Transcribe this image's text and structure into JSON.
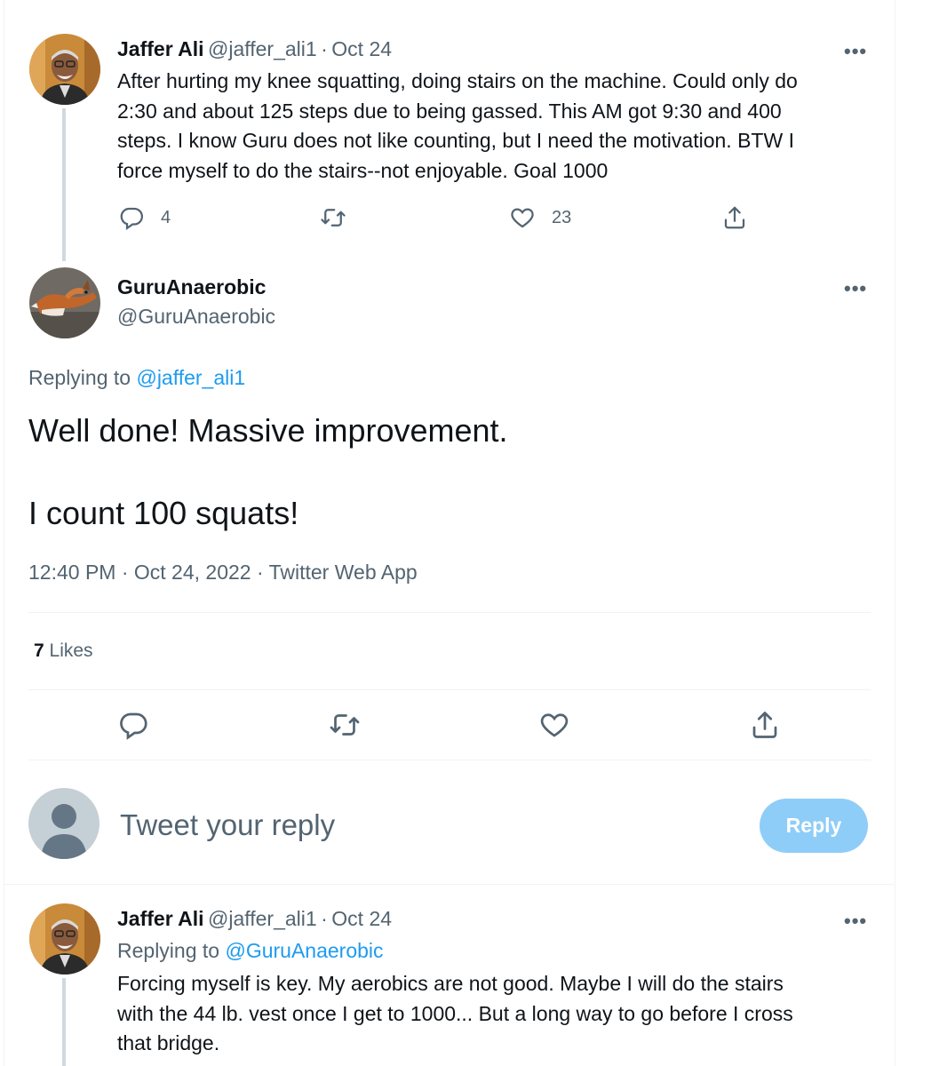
{
  "tweet1": {
    "name": "Jaffer Ali",
    "handle": "@jaffer_ali1",
    "sep": "·",
    "date": "Oct 24",
    "lines": [
      "After hurting my knee squatting, doing stairs on the machine. Could only do",
      "2:30 and about 125 steps due to being gassed. This AM got 9:30 and 400",
      "steps. I know Guru does not like counting, but I need the motivation. BTW I",
      "force myself to do the stairs--not enjoyable. Goal 1000"
    ],
    "reply_count": "4",
    "like_count": "23",
    "more": "•••"
  },
  "main_tweet": {
    "name": "GuruAnaerobic",
    "handle": "@GuruAnaerobic",
    "replying_prefix": "Replying to",
    "replying_handle": "@jaffer_ali1",
    "text_line1": "Well done! Massive improvement.",
    "text_line2": "I count 100 squats!",
    "timestamp": "12:40 PM · Oct 24, 2022 · Twitter Web App",
    "likes_count": "7",
    "likes_label": "Likes",
    "more": "•••"
  },
  "compose": {
    "placeholder": "Tweet your reply",
    "button_label": "Reply"
  },
  "tweet3": {
    "name": "Jaffer Ali",
    "handle": "@jaffer_ali1",
    "sep": "·",
    "date": "Oct 24",
    "replying_prefix": "Replying to",
    "replying_handle": "@GuruAnaerobic",
    "lines": [
      "Forcing myself is key. My aerobics are not good. Maybe I will do the stairs",
      "with the 44 lb. vest once I get to 1000... But a long way to go before I cross",
      "that bridge."
    ],
    "more": "•••"
  },
  "icons": {
    "reply": "reply-icon",
    "retweet": "retweet-icon",
    "like": "heart-icon",
    "share": "share-icon",
    "more": "more-icon"
  },
  "colors": {
    "link": "#1d9bf0",
    "secondary_text": "#536471",
    "reply_button_disabled": "#8ecdf8"
  }
}
